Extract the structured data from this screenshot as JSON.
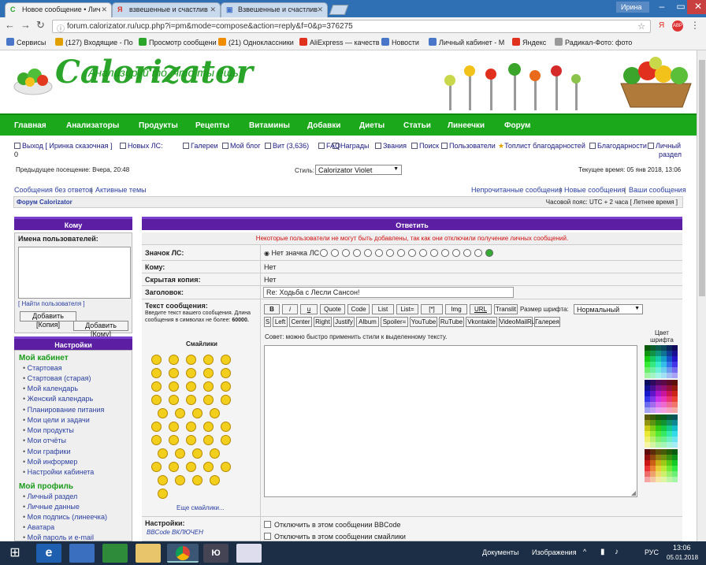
{
  "browser": {
    "tabs": [
      {
        "label": "Новое сообщение • Лич",
        "icon": "С",
        "active": true
      },
      {
        "label": "взвешенные и счастлив",
        "icon": "Я",
        "active": false
      },
      {
        "label": "Взвешенные и счастлив",
        "icon": "▣",
        "active": false
      }
    ],
    "user": "Ирина",
    "url": "forum.calorizator.ru/ucp.php?i=pm&mode=compose&action=reply&f=0&p=376275",
    "bookmarks": [
      {
        "label": "Сервисы",
        "color": "#4a76c9"
      },
      {
        "label": "(127) Входящие - По",
        "color": "#e0a000"
      },
      {
        "label": "Просмотр сообщени",
        "color": "#2aa52a"
      },
      {
        "label": "(21) Одноклассники",
        "color": "#f08c00"
      },
      {
        "label": "AliExpress — качеств",
        "color": "#e0301e"
      },
      {
        "label": "Новости",
        "color": "#4a76c9"
      },
      {
        "label": "Личный кабинет - M",
        "color": "#4a76c9"
      },
      {
        "label": "Яндекс",
        "color": "#e0301e"
      },
      {
        "label": "Радикал-Фото: фото",
        "color": "#999999"
      }
    ]
  },
  "site": {
    "logo": "Calorizator",
    "slogan": "Анализируй то, что ты ешь!",
    "menu": [
      "Главная",
      "Анализаторы",
      "Продукты",
      "Рецепты",
      "Витамины",
      "Добавки",
      "Диеты",
      "Статьи",
      "Линеечки",
      "Форум"
    ],
    "toplinks": {
      "logout": "Выход [ Иринка сказочная ]",
      "logout_count": "0",
      "new_pm": "Новых ЛС:",
      "gallery": "Галереи",
      "blog": "Мой блог",
      "vit": "Вит (3,636)",
      "faq": "FAQ",
      "awards": "Награды",
      "ranks": "Звания",
      "search": "Поиск",
      "users": "Пользователи",
      "thanks_top": "Топлист благодарностей",
      "thanks": "Благодарности",
      "personal": "Личный",
      "personal2": "раздел"
    },
    "last_visit": "Предыдущее посещение: Вчера, 20:48",
    "style_label": "Стиль:",
    "style_value": "Calorizator Violet",
    "current_time": "Текущее время: 05 янв 2018, 13:06",
    "links_left": [
      "Сообщения без ответов",
      "Активные темы"
    ],
    "links_right": [
      "Непрочитанные сообщения",
      "Новые сообщения",
      "Ваши сообщения"
    ],
    "breadcrumb": "Форум Calorizator",
    "timezone": "Часовой пояс: UTC + 2 часа [ Летнее время ]"
  },
  "left_panel": {
    "to_header": "Кому",
    "usernames_label": "Имена пользователей:",
    "find_users": "[ Найти пользователя ]",
    "add_copy": "Добавить [Копия]",
    "add_to": "Добавить [Кому]",
    "settings_header": "Настройки",
    "cabinet_title": "Мой кабинет",
    "cabinet_items": [
      "Стартовая",
      "Стартовая (старая)",
      "Мой календарь",
      "Женский календарь",
      "Планирование питания",
      "Мои цели и задачи",
      "Мои продукты",
      "Мои отчёты",
      "Мои графики",
      "Мой информер",
      "Настройки кабинета"
    ],
    "profile_title": "Мой профиль",
    "profile_items": [
      "Личный раздел",
      "Личные данные",
      "Моя подпись (линеечка)",
      "Аватара",
      "Мой пароль и e-mail"
    ]
  },
  "form": {
    "header": "Ответить",
    "error": "Некоторые пользователи не могут быть добавлены, так как они отключили получение личных сообщений.",
    "icon_label": "Значок ЛС:",
    "no_icon": "Нет значка ЛС",
    "to_label": "Кому:",
    "to_value": "Нет",
    "bcc_label": "Скрытая копия:",
    "bcc_value": "Нет",
    "subject_label": "Заголовок:",
    "subject_value": "Re: Ходьба с Лесли Сансон!",
    "text_label": "Текст сообщения:",
    "text_hint": "Введите текст вашего сообщения. Длина сообщения в символах не более:",
    "text_limit": "60000.",
    "smilies_label": "Смайлики",
    "more_smilies": "Еще смайлики...",
    "toolbar1": [
      "B",
      "i",
      "u",
      "Quote",
      "Code",
      "List",
      "List=",
      "[*]",
      "Img",
      "URL",
      "Translit"
    ],
    "font_size_label": "Размер шрифта:",
    "font_size_value": "Нормальный",
    "toolbar2": [
      "S",
      "Left",
      "Center",
      "Right",
      "Justify",
      "Album",
      "Spoiler=",
      "YouTube",
      "RuTube",
      "Vkontakte",
      "VideoMailRu",
      "Галерея"
    ],
    "tip": "Совет: можно быстро применить стили к выделенному тексту.",
    "color_label": "Цвет шрифта",
    "options_label": "Настройки:",
    "bbcode_on": "BBCode ВКЛЮЧЕН",
    "opt1": "Отключить в этом сообщении BBCode",
    "opt2": "Отключить в этом сообщении смайлики"
  },
  "taskbar": {
    "docs": "Документы",
    "images": "Изображения",
    "lang": "РУС",
    "time": "13:06",
    "date": "05.01.2018"
  }
}
